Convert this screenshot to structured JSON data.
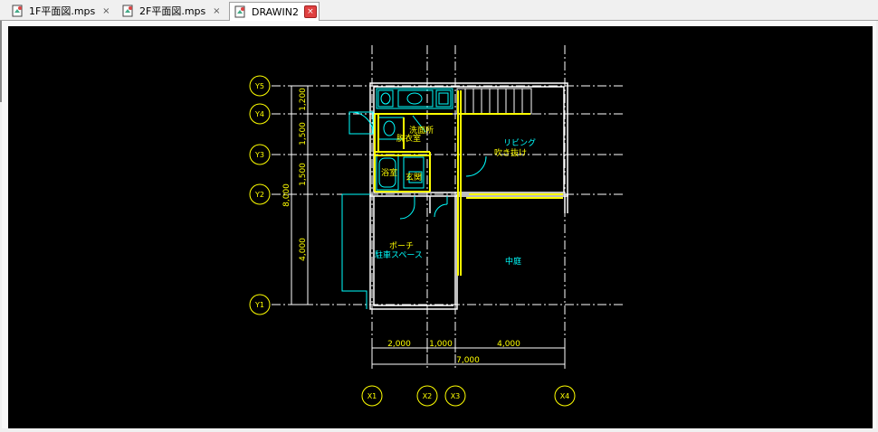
{
  "tabs": [
    {
      "label": "1F平面図.mps",
      "close": "×"
    },
    {
      "label": "2F平面図.mps",
      "close": "×"
    },
    {
      "label": "DRAWIN2",
      "close": "×"
    }
  ],
  "drawing": {
    "grid_labels_y": [
      "Y5",
      "Y4",
      "Y3",
      "Y2",
      "Y1"
    ],
    "grid_labels_x": [
      "X1",
      "X2",
      "X3",
      "X4"
    ],
    "dim_left": [
      "1,200",
      "1,500",
      "1,500",
      "4,000"
    ],
    "dim_left_total": "8,000",
    "dim_bottom": [
      "2,000",
      "1,000",
      "4,000"
    ],
    "dim_bottom_total": "7,000",
    "rooms": {
      "washroom": "洗面所",
      "washroom_sub": "脱衣室",
      "bath": "浴室",
      "entrance": "玄関",
      "living": "リビング",
      "living_sub": "吹き抜け",
      "porch": "ポーチ",
      "parking": "駐車スペース",
      "courtyard": "中庭"
    }
  },
  "colors": {
    "canvas": "#000000",
    "grid": "#ffffff",
    "yellow": "#ffff00",
    "cyan": "#00ffff"
  }
}
